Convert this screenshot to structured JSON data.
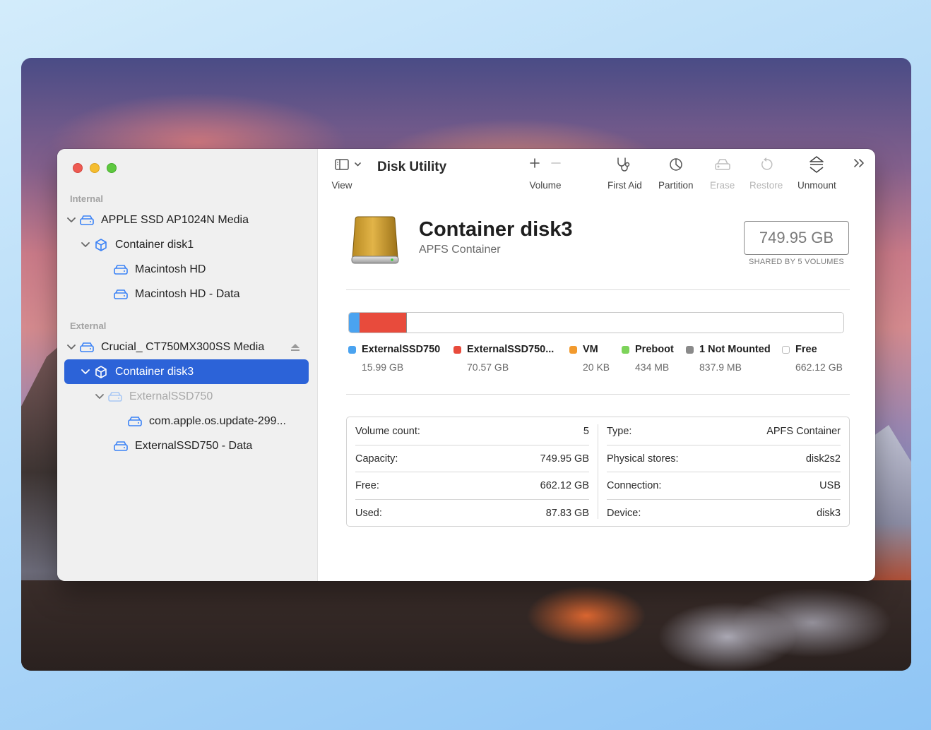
{
  "app": {
    "title": "Disk Utility"
  },
  "sidebar": {
    "internal_label": "Internal",
    "external_label": "External",
    "items": [
      {
        "label": "APPLE SSD AP1024N Media",
        "kind": "disk",
        "icon": "drive-icon"
      },
      {
        "label": "Container disk1",
        "kind": "container",
        "icon": "container-icon"
      },
      {
        "label": "Macintosh HD",
        "kind": "volume",
        "icon": "drive-icon"
      },
      {
        "label": "Macintosh HD - Data",
        "kind": "volume",
        "icon": "drive-icon"
      },
      {
        "label": "Crucial_ CT750MX300SS Media",
        "kind": "disk",
        "icon": "drive-icon"
      },
      {
        "label": "Container disk3",
        "kind": "container",
        "icon": "container-icon",
        "selected": true
      },
      {
        "label": "ExternalSSD750",
        "kind": "volume",
        "icon": "drive-icon",
        "dimmed": true
      },
      {
        "label": "com.apple.os.update-299...",
        "kind": "snapshot",
        "icon": "drive-icon"
      },
      {
        "label": "ExternalSSD750 - Data",
        "kind": "volume",
        "icon": "drive-icon"
      }
    ]
  },
  "toolbar": {
    "view_label": "View",
    "volume_label": "Volume",
    "first_aid_label": "First Aid",
    "partition_label": "Partition",
    "erase_label": "Erase",
    "restore_label": "Restore",
    "unmount_label": "Unmount"
  },
  "detail": {
    "name": "Container disk3",
    "type": "APFS Container",
    "capacity": "749.95 GB",
    "shared_note": "SHARED BY 5 VOLUMES"
  },
  "usage": {
    "total_gb": 749.95,
    "segments": [
      {
        "name": "ExternalSSD750",
        "value": "15.99 GB",
        "gb": 15.99,
        "color": "#4aa3f0"
      },
      {
        "name": "ExternalSSD750...",
        "value": "70.57 GB",
        "gb": 70.57,
        "color": "#e84b3c"
      },
      {
        "name": "VM",
        "value": "20 KB",
        "gb": 2e-05,
        "color": "#f29a2e"
      },
      {
        "name": "Preboot",
        "value": "434 MB",
        "gb": 0.434,
        "color": "#7dd35a"
      },
      {
        "name": "1 Not Mounted",
        "value": "837.9 MB",
        "gb": 0.8379,
        "color": "#8a8a8a"
      },
      {
        "name": "Free",
        "value": "662.12 GB",
        "gb": 662.12,
        "color": "#ffffff"
      }
    ]
  },
  "info": {
    "left": [
      {
        "label": "Volume count:",
        "value": "5"
      },
      {
        "label": "Capacity:",
        "value": "749.95 GB"
      },
      {
        "label": "Free:",
        "value": "662.12 GB"
      },
      {
        "label": "Used:",
        "value": "87.83 GB"
      }
    ],
    "right": [
      {
        "label": "Type:",
        "value": "APFS Container"
      },
      {
        "label": "Physical stores:",
        "value": "disk2s2"
      },
      {
        "label": "Connection:",
        "value": "USB"
      },
      {
        "label": "Device:",
        "value": "disk3"
      }
    ]
  }
}
